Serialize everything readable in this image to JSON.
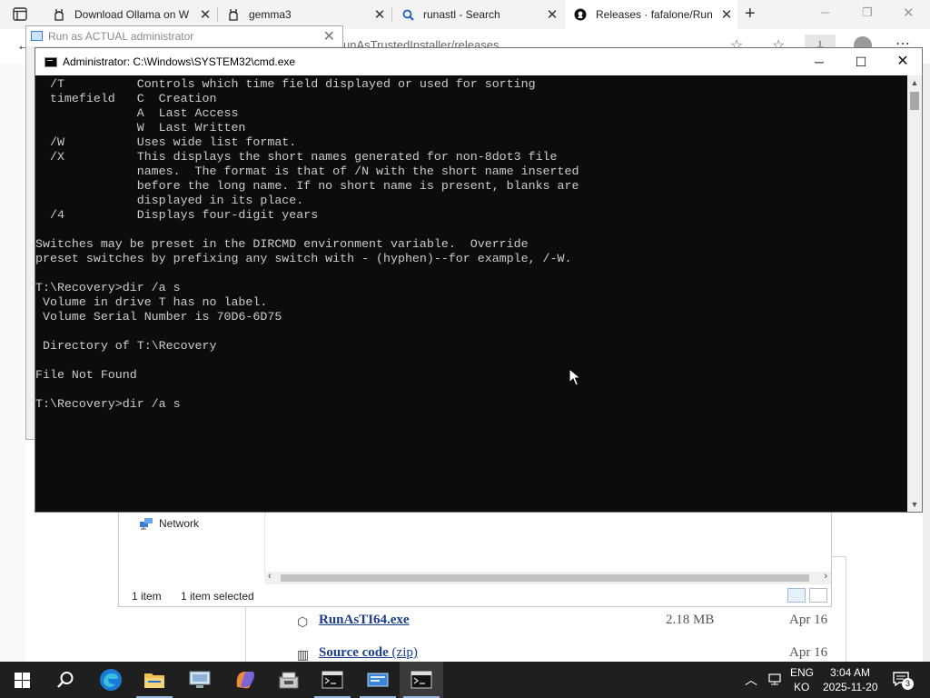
{
  "browser": {
    "tabs": [
      {
        "title": "Download Ollama on W",
        "icon": "ollama-icon",
        "active": false
      },
      {
        "title": "gemma3",
        "icon": "ollama-icon",
        "active": false
      },
      {
        "title": "runastl - Search",
        "icon": "search-icon",
        "active": false
      },
      {
        "title": "Releases · fafalone/Run",
        "icon": "github-icon",
        "active": true
      }
    ],
    "new_tab_symbol": "+",
    "url_partial": "unAsTrustedInstaller/releases"
  },
  "run_dialog": {
    "title": "Run as ACTUAL administrator",
    "close": "✕"
  },
  "cmd": {
    "title": "Administrator: C:\\Windows\\SYSTEM32\\cmd.exe",
    "minimize": "─",
    "maximize": "☐",
    "close": "✕",
    "lines": [
      "  /T          Controls which time field displayed or used for sorting",
      "  timefield   C  Creation",
      "              A  Last Access",
      "              W  Last Written",
      "  /W          Uses wide list format.",
      "  /X          This displays the short names generated for non-8dot3 file",
      "              names.  The format is that of /N with the short name inserted",
      "              before the long name. If no short name is present, blanks are",
      "              displayed in its place.",
      "  /4          Displays four-digit years",
      "",
      "Switches may be preset in the DIRCMD environment variable.  Override",
      "preset switches by prefixing any switch with - (hyphen)--for example, /-W.",
      "",
      "T:\\Recovery>dir /a s",
      " Volume in drive T has no label.",
      " Volume Serial Number is 70D6-6D75",
      "",
      " Directory of T:\\Recovery",
      "",
      "File Not Found",
      "",
      "T:\\Recovery>dir /a s"
    ]
  },
  "explorer": {
    "nav_item": "Network",
    "status_count": "1 item",
    "status_selected": "1 item selected"
  },
  "assets": [
    {
      "name": "RunAsTI64.exe",
      "extra": "",
      "size": "2.18 MB",
      "date": "Apr 16",
      "icon": "package-icon"
    },
    {
      "name": "Source code",
      "extra": "(zip)",
      "size": "",
      "date": "Apr 16",
      "icon": "zip-icon"
    }
  ],
  "taskbar": {
    "icons": [
      "start-icon",
      "search-icon",
      "edge-icon",
      "file-explorer-icon",
      "remote-desktop-icon",
      "copilot-icon",
      "app-icon",
      "cmd-icon",
      "run-as-icon",
      "cmd-icon"
    ],
    "tray_lang_top": "ENG",
    "tray_lang_bottom": "KO",
    "time": "3:04 AM",
    "date": "2025-11-20",
    "notification_count": "3"
  },
  "colors": {
    "console_bg": "#0c0c0c",
    "console_fg": "#cccccc",
    "taskbar_bg": "#1f1f1f",
    "link": "#1a3d8f"
  }
}
